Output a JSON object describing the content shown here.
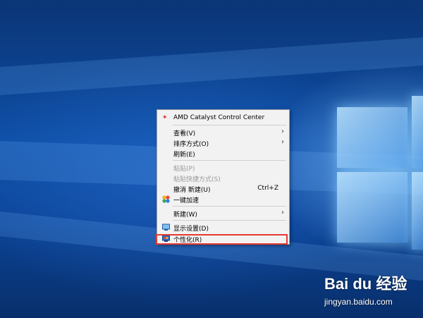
{
  "context_menu": {
    "items": [
      {
        "label": "AMD Catalyst Control Center",
        "icon": "amd-icon"
      },
      {
        "label": "查看(V)",
        "submenu": true
      },
      {
        "label": "排序方式(O)",
        "submenu": true
      },
      {
        "label": "刷新(E)"
      },
      {
        "label": "粘贴(P)",
        "disabled": true
      },
      {
        "label": "粘贴快捷方式(S)",
        "disabled": true
      },
      {
        "label": "撤消 新建(U)",
        "shortcut": "Ctrl+Z"
      },
      {
        "label": "一键加速",
        "icon": "speedup-icon"
      },
      {
        "label": "新建(W)",
        "submenu": true
      },
      {
        "label": "显示设置(D)",
        "icon": "display-settings-icon"
      },
      {
        "label": "个性化(R)",
        "icon": "personalize-icon"
      }
    ],
    "chevron": "›",
    "amd_glyph": "✶"
  },
  "watermark": {
    "brand": "Bai du 经验",
    "url": "jingyan.baidu.com"
  },
  "colors": {
    "highlight": "#e53935",
    "desktop_blue": "#0d4ea6"
  }
}
